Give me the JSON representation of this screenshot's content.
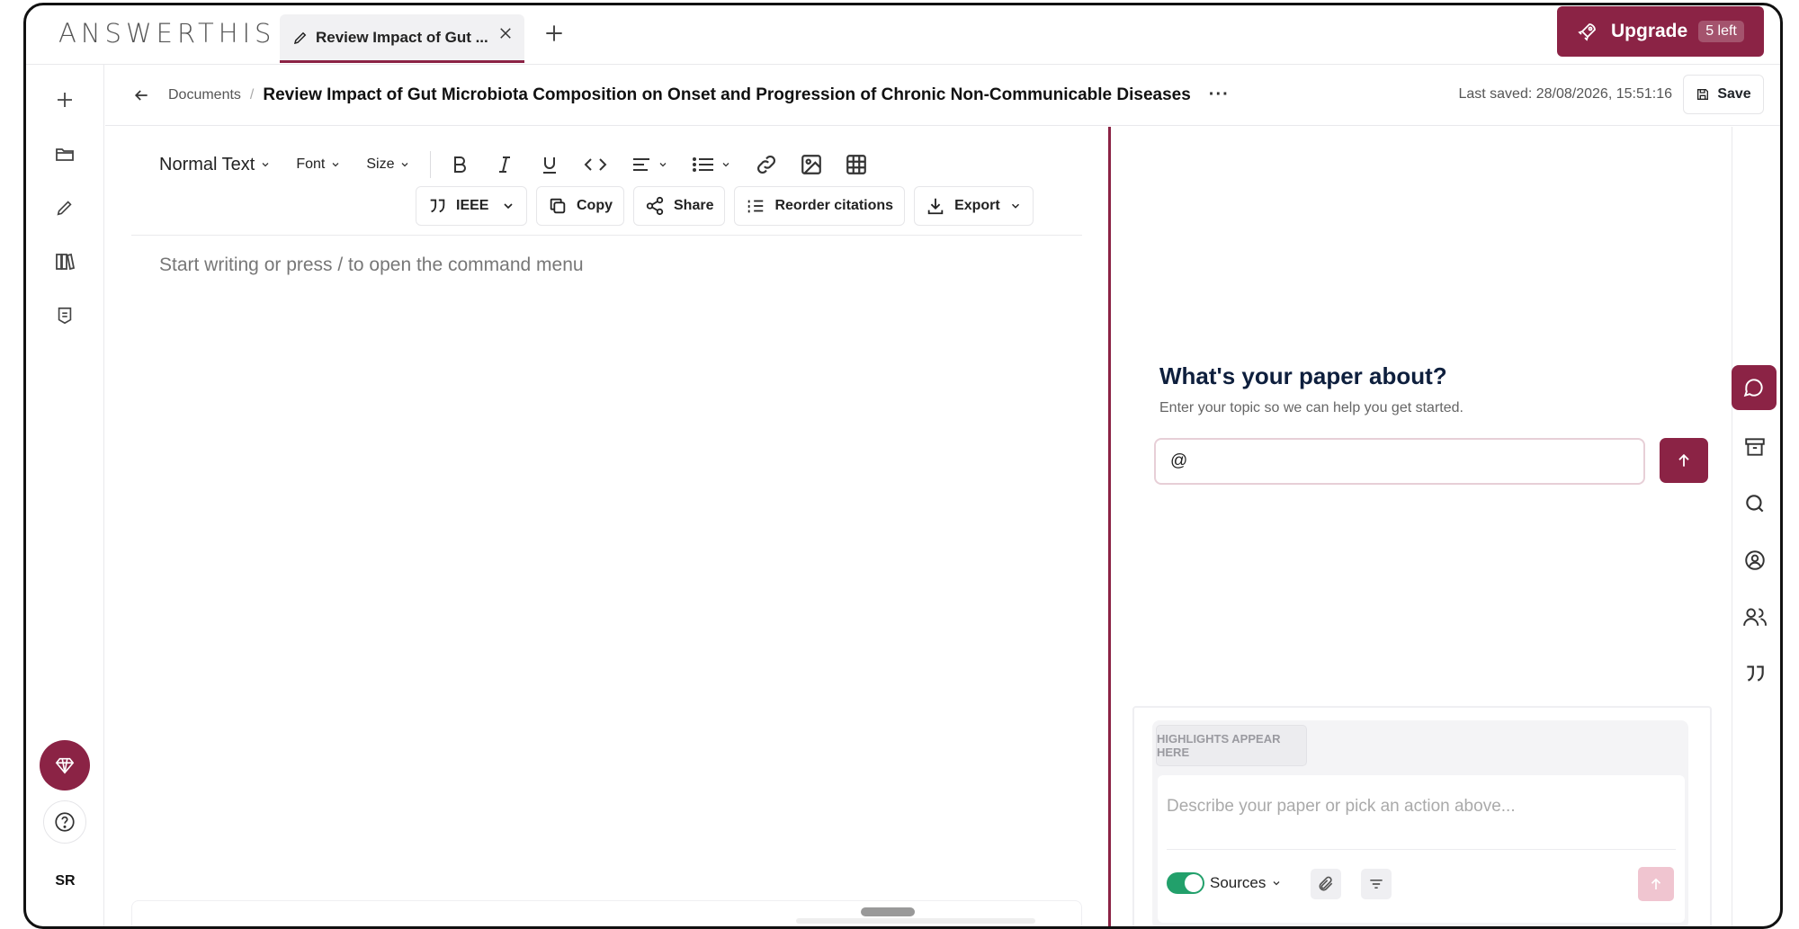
{
  "app": {
    "logo": "ANSWERTHIS"
  },
  "tabs": [
    {
      "label": "Review Impact of Gut ..."
    }
  ],
  "upgrade": {
    "label": "Upgrade",
    "badge": "5 left"
  },
  "breadcrumb": {
    "parent": "Documents",
    "separator": "/",
    "title": "Review Impact of Gut Microbiota Composition on Onset and Progression of Chronic Non-Communicable Diseases",
    "more": "···"
  },
  "status": {
    "last_saved": "Last saved: 28/08/2026, 15:51:16",
    "save_label": "Save"
  },
  "toolbar": {
    "style": "Normal Text",
    "font": "Font",
    "size": "Size",
    "citation_style": "IEEE",
    "copy": "Copy",
    "share": "Share",
    "reorder": "Reorder citations",
    "export": "Export"
  },
  "editor": {
    "placeholder": "Start writing or press / to open the command menu"
  },
  "sidebar": {
    "user_initials": "SR"
  },
  "assistant": {
    "title": "What's your paper about?",
    "subtitle": "Enter your topic so we can help you get started.",
    "topic_value": "@",
    "highlights_label": "HIGHLIGHTS APPEAR HERE",
    "chat_placeholder": "Describe your paper or pick an action above...",
    "sources_label": "Sources"
  },
  "colors": {
    "accent": "#8b2345",
    "toggle_on": "#22a06b"
  },
  "icons": [
    "plus-icon",
    "folder-icon",
    "pencil-icon",
    "books-icon",
    "notes-icon",
    "gem-icon",
    "help-icon",
    "chat-icon",
    "archive-icon",
    "search-icon",
    "user-circle-icon",
    "users-icon",
    "quote-icon"
  ]
}
